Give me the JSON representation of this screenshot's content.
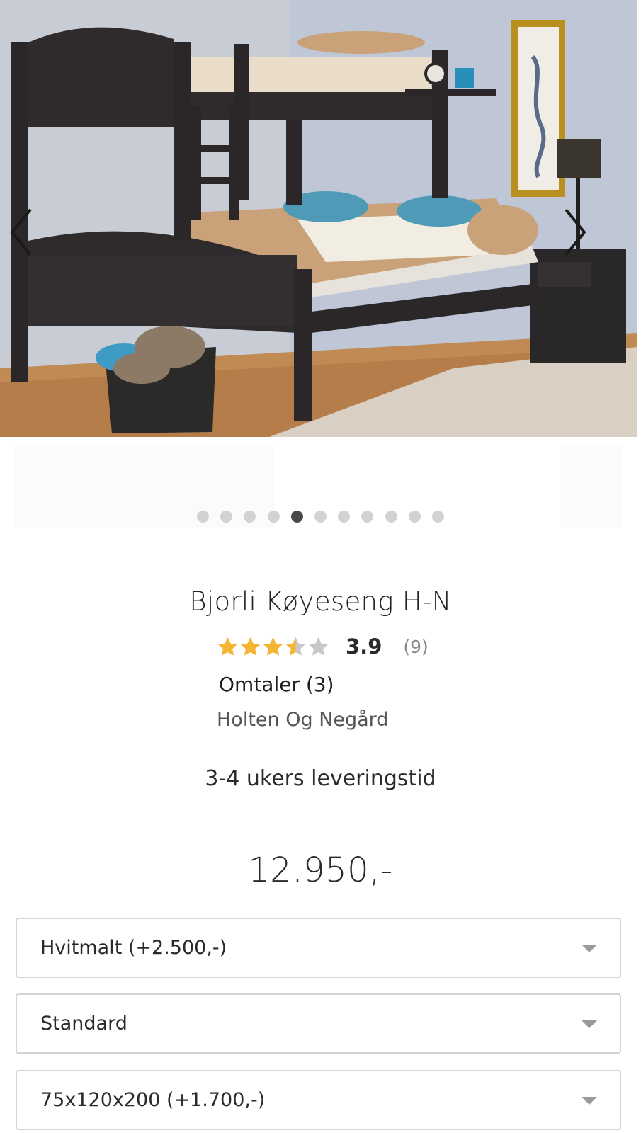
{
  "gallery": {
    "image_alt": "Bjorli Køyeseng H-N",
    "slide_count": 11,
    "active_index": 4,
    "prev_icon": "chevron-left-icon",
    "next_icon": "chevron-right-icon"
  },
  "product": {
    "title": "Bjorli Køyeseng H-N",
    "rating": {
      "stars_filled": 3.5,
      "stars_max": 5,
      "value": "3.9",
      "count": "(9)",
      "star_color": "#f5b533",
      "star_empty_color": "#c8c8c8"
    },
    "reviews_link": "Omtaler (3)",
    "brand": "Holten Og Negård",
    "delivery": "3-4 ukers leveringstid",
    "price": "12.950,-"
  },
  "options": [
    {
      "selected": "Hvitmalt (+2.500,-)"
    },
    {
      "selected": "Standard"
    },
    {
      "selected": "75x120x200 (+1.700,-)"
    }
  ]
}
